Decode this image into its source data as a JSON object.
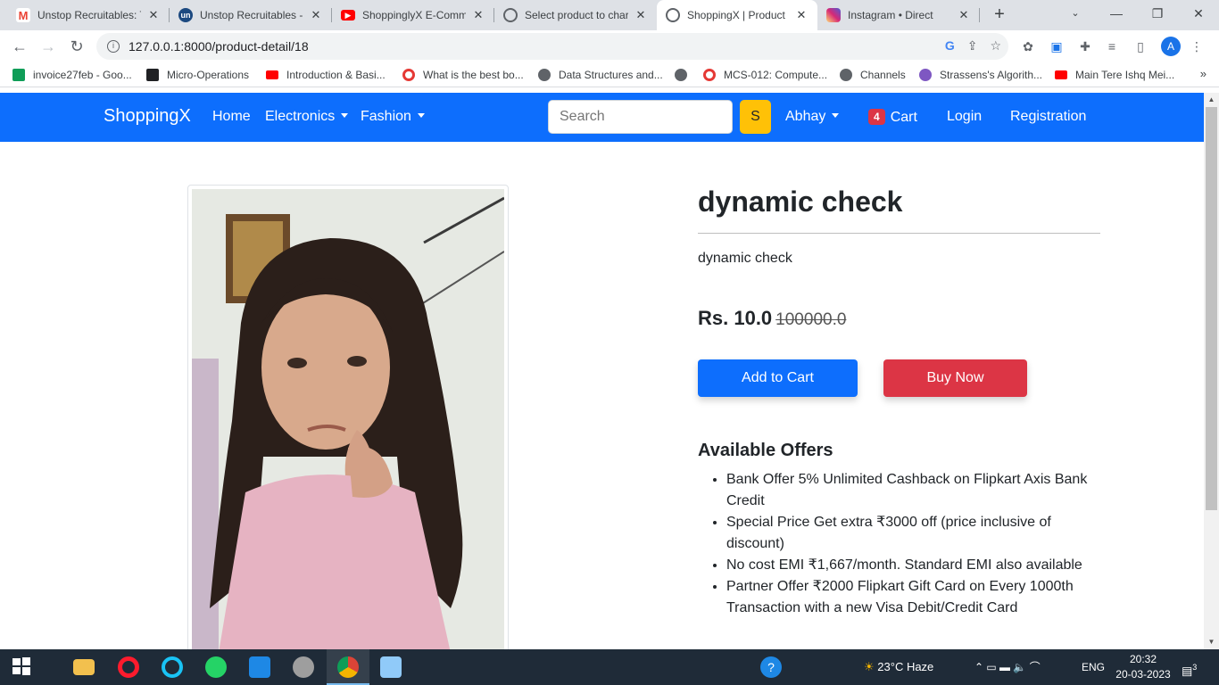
{
  "browser": {
    "tabs": [
      {
        "title": "Unstop Recruitables: T",
        "icon": "gmail-icon",
        "color": "#ea4335"
      },
      {
        "title": "Unstop Recruitables -",
        "icon": "unstop-icon",
        "color": "#1c4980"
      },
      {
        "title": "ShoppinglyX E-Comm",
        "icon": "youtube-icon",
        "color": "#ff0000"
      },
      {
        "title": "Select product to char",
        "icon": "globe-icon",
        "color": "#5f6368"
      },
      {
        "title": "ShoppingX | Product D",
        "icon": "globe-icon",
        "color": "#5f6368"
      },
      {
        "title": "Instagram • Direct",
        "icon": "instagram-icon",
        "color": "#d62976"
      }
    ],
    "url": "127.0.0.1:8000/product-detail/18",
    "profile_initial": "A",
    "bookmarks": [
      {
        "label": "invoice27feb - Goo...",
        "icon": "sheets-icon",
        "color": "#0f9d58"
      },
      {
        "label": "Micro-Operations",
        "icon": "bookmark-icon",
        "color": "#202124"
      },
      {
        "label": "Introduction & Basi...",
        "icon": "youtube-icon",
        "color": "#ff0000"
      },
      {
        "label": "What is the best bo...",
        "icon": "quora-icon",
        "color": "#e53935"
      },
      {
        "label": "Data Structures and...",
        "icon": "globe-icon",
        "color": "#5f6368"
      },
      {
        "label": "",
        "icon": "globe-icon",
        "color": "#5f6368"
      },
      {
        "label": "MCS-012: Compute...",
        "icon": "target-icon",
        "color": "#e53935"
      },
      {
        "label": "Channels",
        "icon": "globe-icon",
        "color": "#5f6368"
      },
      {
        "label": "Strassens's Algorith...",
        "icon": "wave-icon",
        "color": "#7e57c2"
      },
      {
        "label": "Main Tere Ishq Mei...",
        "icon": "youtube-icon",
        "color": "#ff0000"
      }
    ]
  },
  "navbar": {
    "brand": "ShoppingX",
    "home": "Home",
    "electronics": "Electronics",
    "fashion": "Fashion",
    "search_placeholder": "Search",
    "search_button": "S",
    "user": "Abhay",
    "cart_count": "4",
    "cart": "Cart",
    "login": "Login",
    "registration": "Registration",
    "color": "#0d6efd"
  },
  "product": {
    "title": "dynamic check",
    "description": "dynamic check",
    "price": "Rs. 10.0",
    "old_price": "100000.0",
    "add_to_cart": "Add to Cart",
    "buy_now": "Buy Now",
    "offers_heading": "Available Offers",
    "offers": [
      "Bank Offer 5% Unlimited Cashback on Flipkart Axis Bank Credit",
      "Special Price Get extra ₹3000 off (price inclusive of discount)",
      "No cost EMI ₹1,667/month. Standard EMI also available",
      "Partner Offer ₹2000 Flipkart Gift Card on Every 1000th Transaction with a new Visa Debit/Credit Card"
    ]
  },
  "taskbar": {
    "weather": "23°C  Haze",
    "language": "ENG",
    "time": "20:32",
    "date": "20-03-2023",
    "notifications": "3"
  }
}
